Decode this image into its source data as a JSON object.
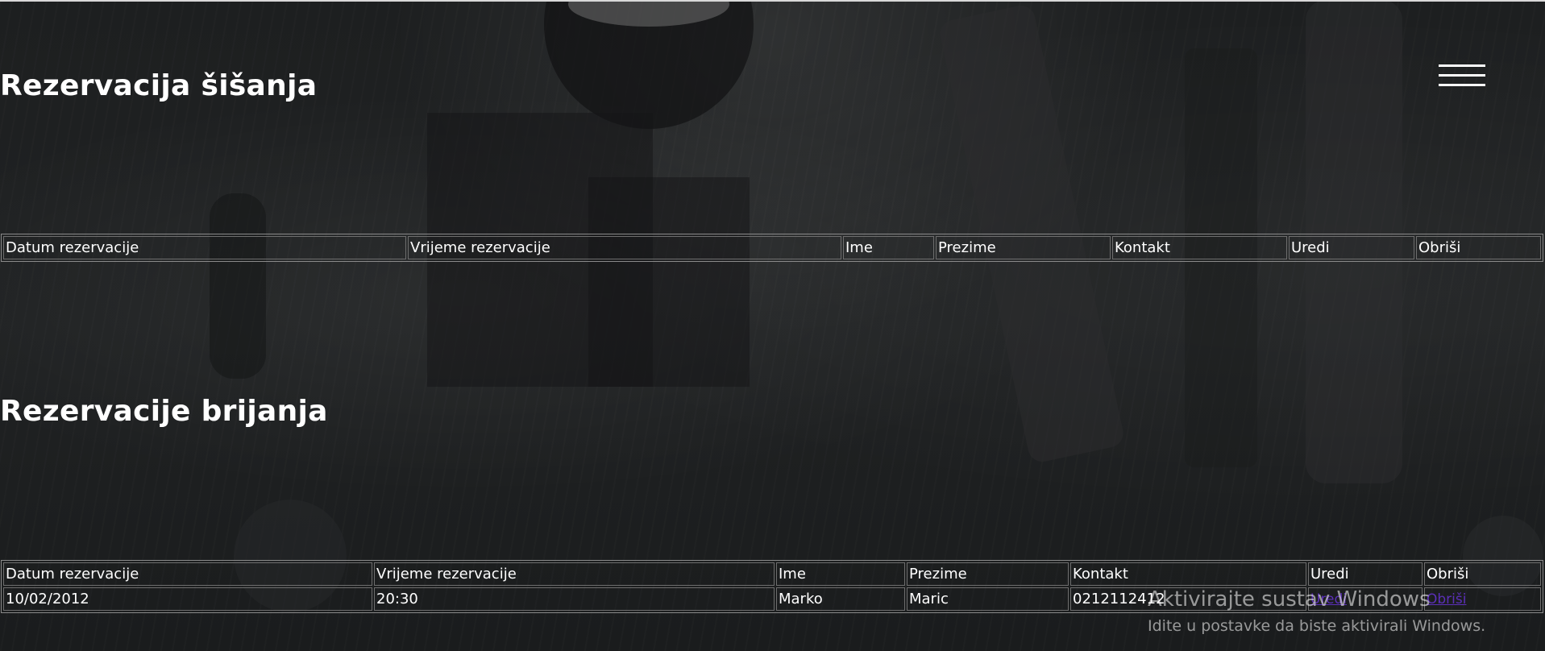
{
  "page": {
    "title_haircut": "Rezervacija šišanja",
    "title_shave": "Rezervacije brijanja"
  },
  "menu": {
    "icon": "hamburger-menu-icon"
  },
  "haircut_table": {
    "headers": [
      "Datum rezervacije",
      "Vrijeme rezervacije",
      "Ime",
      "Prezime",
      "Kontakt",
      "Uredi",
      "Obriši"
    ],
    "rows": []
  },
  "shave_table": {
    "headers": [
      "Datum rezervacije",
      "Vrijeme rezervacije",
      "Ime",
      "Prezime",
      "Kontakt",
      "Uredi",
      "Obriši"
    ],
    "rows": [
      {
        "date": "10/02/2012",
        "time": "20:30",
        "first_name": "Marko",
        "last_name": "Maric",
        "contact": "0212112412",
        "edit_label": "Uredi",
        "delete_label": "Obriši"
      }
    ]
  },
  "windows_watermark": {
    "line1": "Aktivirajte sustav Windows",
    "line2": "Idite u postavke da biste aktivirali Windows."
  },
  "colors": {
    "background": "#1d1f20",
    "text": "#ffffff",
    "link": "#5b2fb8",
    "border": "#8a8a8a"
  }
}
